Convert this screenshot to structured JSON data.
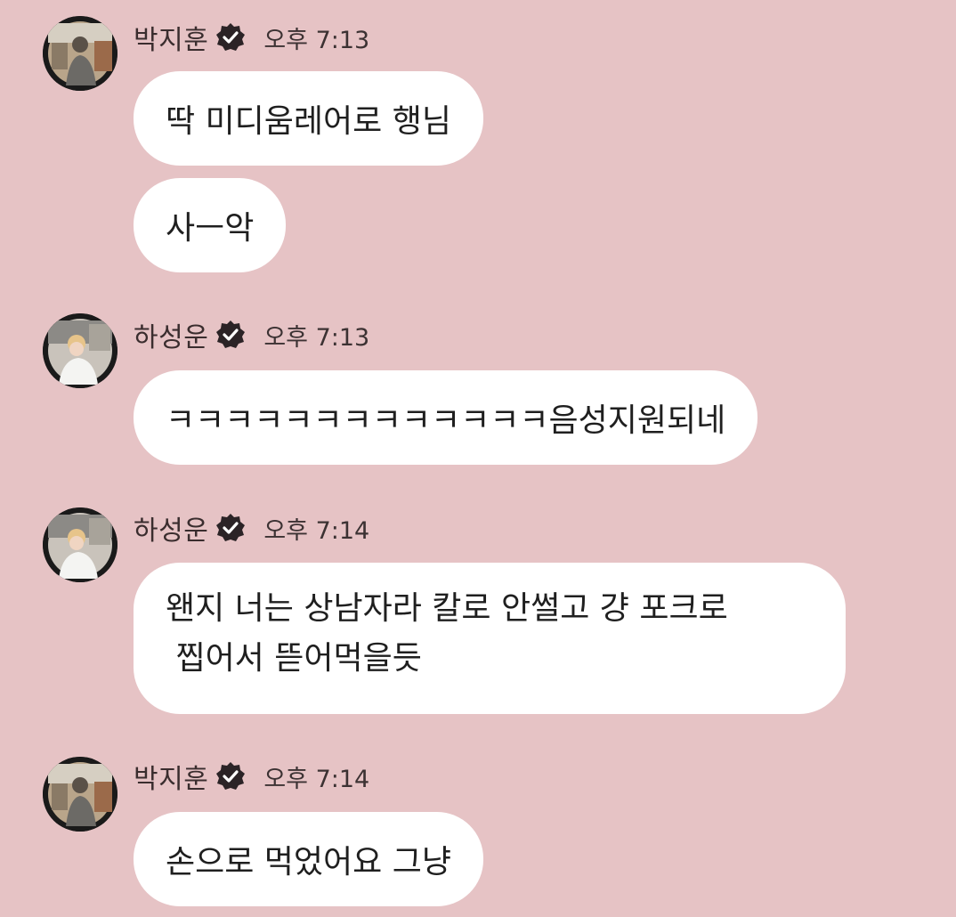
{
  "messages": [
    {
      "sender": "박지훈",
      "time": "오후 7:13",
      "avatar_icon": "profile-photo-jihoon",
      "bubbles": [
        "딱 미디움레어로 행님",
        "사ㅡ악"
      ]
    },
    {
      "sender": "하성운",
      "time": "오후 7:13",
      "avatar_icon": "profile-photo-sungwoon",
      "bubbles": [
        "ㅋㅋㅋㅋㅋㅋㅋㅋㅋㅋㅋㅋㅋ음성지원되네"
      ]
    },
    {
      "sender": "하성운",
      "time": "오후 7:14",
      "avatar_icon": "profile-photo-sungwoon",
      "bubbles": [
        {
          "lines": [
            "왠지 너는 상남자라 칼로 안썰고 걍 포크로",
            " 찝어서 뜯어먹을듯"
          ]
        }
      ]
    },
    {
      "sender": "박지훈",
      "time": "오후 7:14",
      "avatar_icon": "profile-photo-jihoon",
      "bubbles": [
        "손으로 먹었어요 그냥"
      ]
    }
  ],
  "verified_badge_icon": "verified-check-icon",
  "colors": {
    "background": "#e6c3c5",
    "bubble": "#ffffff",
    "badge": "#2b2326"
  }
}
